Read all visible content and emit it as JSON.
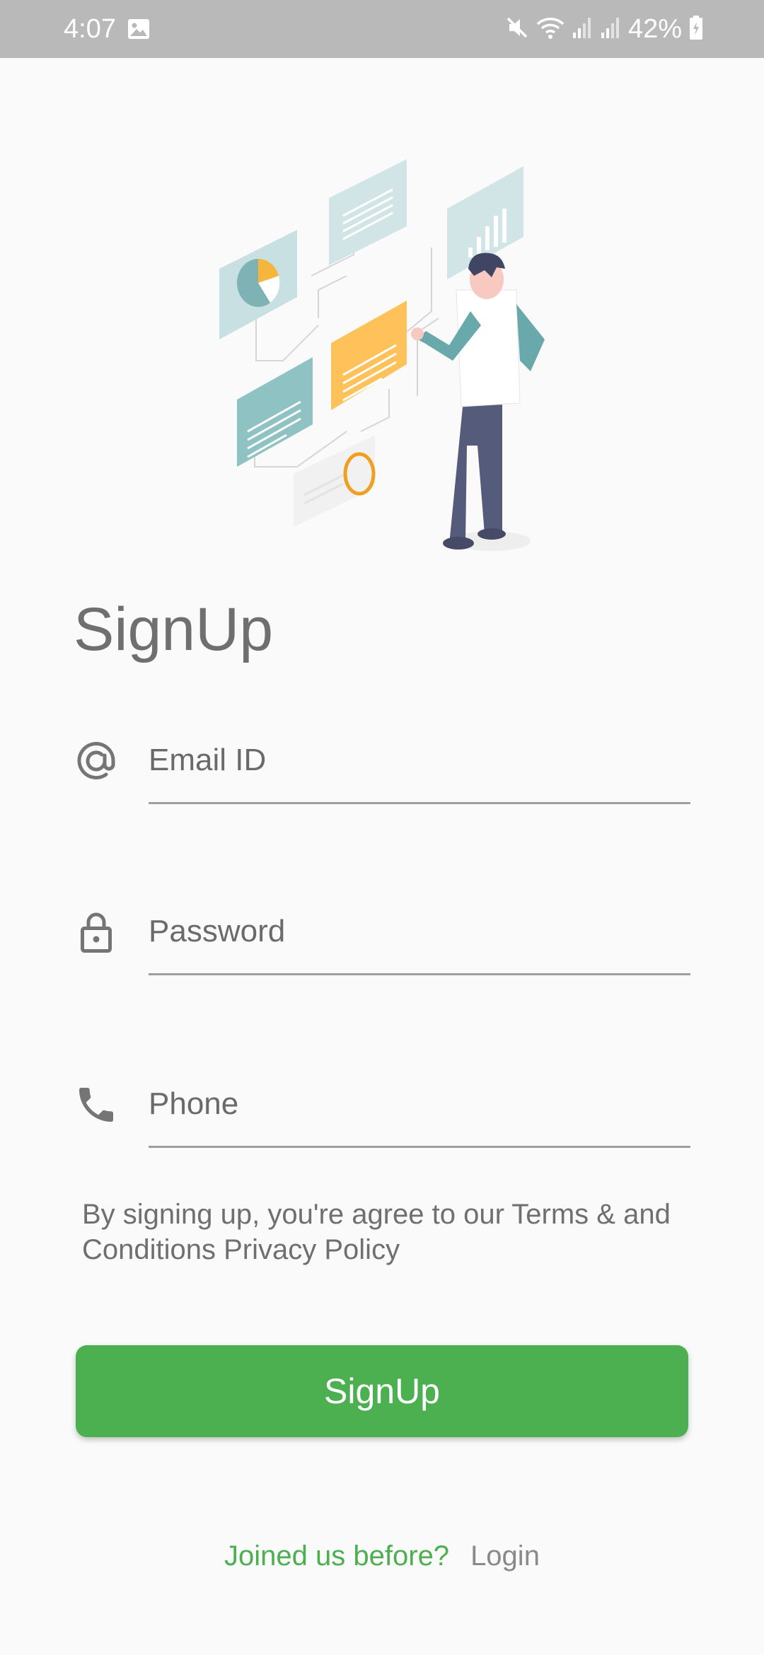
{
  "status_bar": {
    "time": "4:07",
    "battery": "42%",
    "icons": [
      "gallery-icon",
      "mute-icon",
      "wifi-icon",
      "signal-icon",
      "signal-icon",
      "battery-icon"
    ]
  },
  "colors": {
    "accent": "#4caf50",
    "text": "#6f6f6f",
    "status_bar": "#b9b9b9"
  },
  "title": "SignUp",
  "form": {
    "email": {
      "placeholder": "Email ID",
      "value": "",
      "icon": "at-icon"
    },
    "password": {
      "placeholder": "Password",
      "value": "",
      "icon": "lock-icon"
    },
    "phone": {
      "placeholder": "Phone",
      "value": "",
      "icon": "phone-icon"
    }
  },
  "terms_text": "By signing up, you're agree to our Terms & and Conditions Privacy Policy",
  "signup_button_label": "SignUp",
  "footer": {
    "prompt": "Joined us before?",
    "login_label": "Login"
  }
}
